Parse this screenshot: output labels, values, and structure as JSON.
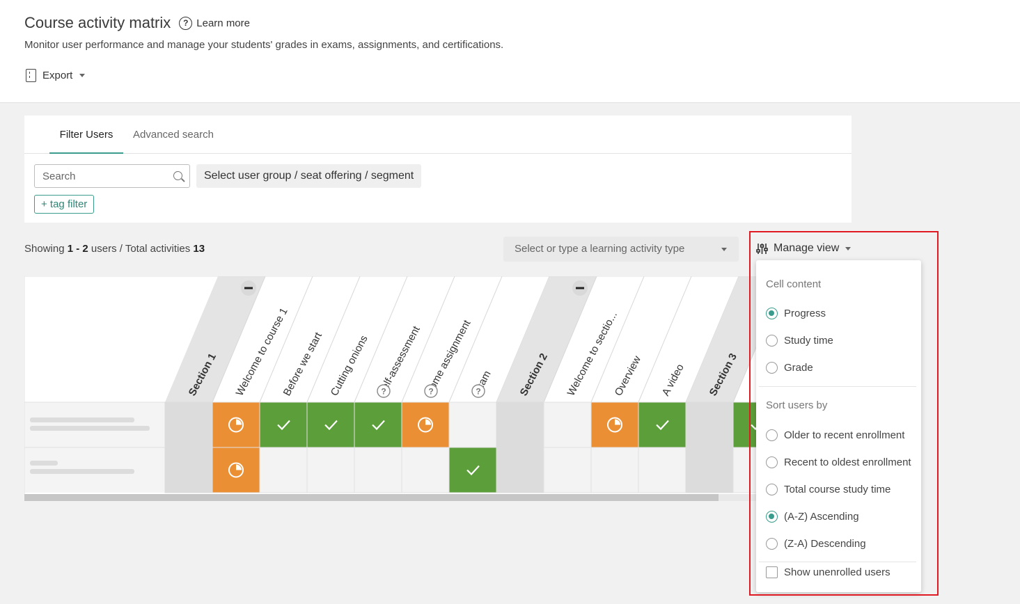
{
  "header": {
    "title": "Course activity matrix",
    "learn_more": "Learn more",
    "subtitle": "Monitor user performance and manage your students' grades in exams, assignments, and certifications.",
    "export_label": "Export"
  },
  "filters": {
    "tabs": [
      "Filter Users",
      "Advanced search"
    ],
    "active_tab": "Filter Users",
    "search_placeholder": "Search",
    "segment_button": "Select user group / seat offering / segment",
    "tag_filter": "+ tag filter"
  },
  "summary": {
    "showing_prefix": "Showing",
    "range": "1 - 2",
    "users_label": "users",
    "total_prefix": "/ Total activities",
    "total": "13"
  },
  "activity_type_select": {
    "placeholder": "Select or type a learning activity type"
  },
  "manage_view": {
    "label": "Manage view",
    "cell_content": {
      "heading": "Cell content",
      "options": [
        "Progress",
        "Study time",
        "Grade"
      ],
      "selected": "Progress"
    },
    "sort_users": {
      "heading": "Sort users by",
      "options": [
        "Older to recent enrollment",
        "Recent to oldest enrollment",
        "Total course study time",
        "(A-Z) Ascending",
        "(Z-A) Descending"
      ],
      "selected": "(A-Z) Ascending"
    },
    "show_unenrolled": {
      "label": "Show unenrolled users",
      "checked": false
    }
  },
  "matrix": {
    "columns": [
      {
        "label": "Section 1",
        "kind": "section",
        "collapse": true
      },
      {
        "label": "Welcome to course 1",
        "kind": "activity"
      },
      {
        "label": "Before we start",
        "kind": "activity"
      },
      {
        "label": "Cutting onions",
        "kind": "activity"
      },
      {
        "label": "Self-assessment",
        "kind": "activity",
        "help": true
      },
      {
        "label": "Home assignment",
        "kind": "activity",
        "help": true
      },
      {
        "label": "Exam",
        "kind": "activity",
        "help": true
      },
      {
        "label": "Section 2",
        "kind": "section",
        "collapse": true
      },
      {
        "label": "Welcome to sectio...",
        "kind": "activity"
      },
      {
        "label": "Overview",
        "kind": "activity"
      },
      {
        "label": "A video",
        "kind": "activity"
      },
      {
        "label": "Section 3",
        "kind": "section"
      },
      {
        "label": "",
        "kind": "activity"
      }
    ],
    "rows": [
      {
        "user": "",
        "cells": [
          "section",
          "progress",
          "done",
          "done",
          "done",
          "progress",
          "empty",
          "section",
          "empty",
          "progress",
          "done",
          "section",
          "done"
        ]
      },
      {
        "user": "",
        "cells": [
          "section",
          "progress",
          "empty",
          "empty",
          "empty",
          "empty",
          "done",
          "section",
          "empty",
          "empty",
          "empty",
          "section",
          "empty"
        ]
      }
    ],
    "colors": {
      "done": "#5c9e3a",
      "progress": "#ea8f34",
      "section": "#dcdcdc",
      "empty": "#f3f3f3"
    }
  }
}
